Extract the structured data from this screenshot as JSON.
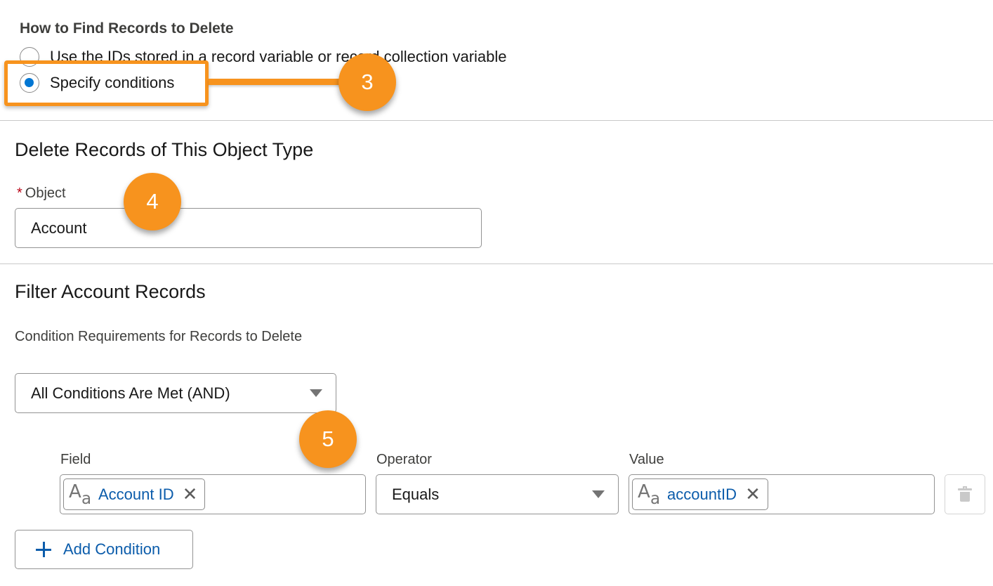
{
  "find_records": {
    "label": "How to Find Records to Delete",
    "options": [
      {
        "label": "Use the IDs stored in a record variable or record collection variable",
        "selected": false
      },
      {
        "label": "Specify conditions",
        "selected": true
      }
    ]
  },
  "callouts": [
    "3",
    "4",
    "5"
  ],
  "object_section": {
    "heading": "Delete Records of This Object Type",
    "required_mark": "*",
    "object_label": "Object",
    "object_value": "Account"
  },
  "filter_section": {
    "heading": "Filter Account Records",
    "condition_label": "Condition Requirements for Records to Delete",
    "condition_value": "All Conditions Are Met (AND)",
    "columns": {
      "field": "Field",
      "operator": "Operator",
      "value": "Value"
    },
    "row": {
      "field_icon": "text-type-icon",
      "field": "Account ID",
      "operator": "Equals",
      "value_icon": "text-type-icon",
      "value": "accountID"
    },
    "add_condition_label": "Add Condition"
  },
  "colors": {
    "callout": "#f7931e",
    "brand_blue": "#0176d3",
    "link_blue": "#0b5cab"
  }
}
